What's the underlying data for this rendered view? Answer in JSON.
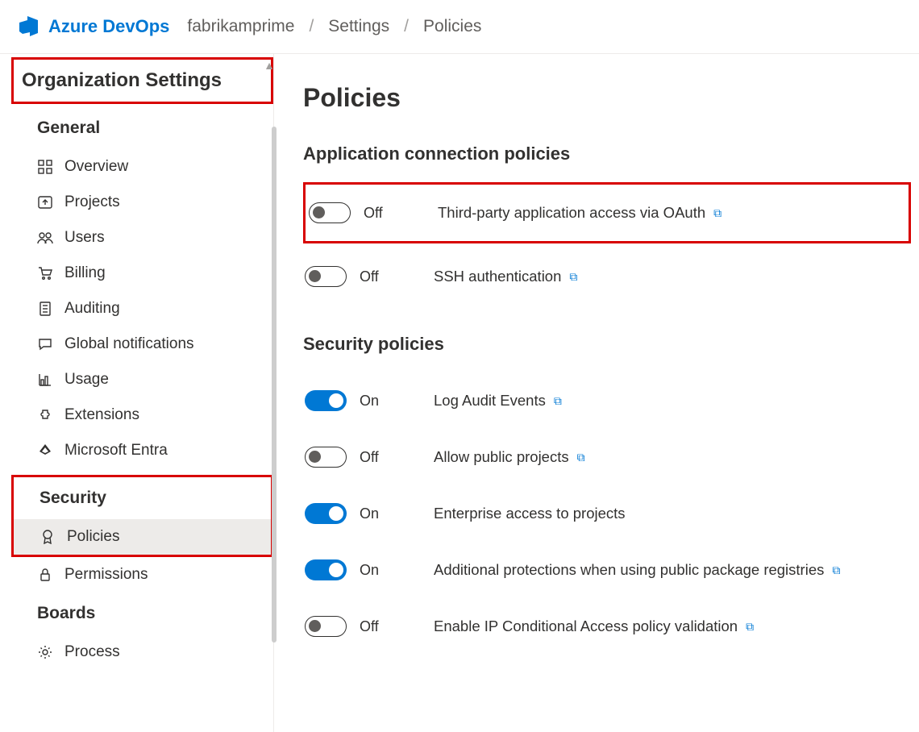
{
  "header": {
    "brand": "Azure DevOps",
    "breadcrumb": {
      "org": "fabrikamprime",
      "settings": "Settings",
      "policies": "Policies"
    }
  },
  "sidebar": {
    "title": "Organization Settings",
    "general_heading": "General",
    "general": {
      "overview": "Overview",
      "projects": "Projects",
      "users": "Users",
      "billing": "Billing",
      "auditing": "Auditing",
      "global_notifications": "Global notifications",
      "usage": "Usage",
      "extensions": "Extensions",
      "entra": "Microsoft Entra"
    },
    "security_heading": "Security",
    "security": {
      "policies": "Policies",
      "permissions": "Permissions"
    },
    "boards_heading": "Boards",
    "boards": {
      "process": "Process"
    }
  },
  "main": {
    "title": "Policies",
    "app_conn_heading": "Application connection policies",
    "sec_policies_heading": "Security policies",
    "on": "On",
    "off": "Off",
    "policies": {
      "oauth": "Third-party application access via OAuth",
      "ssh": "SSH authentication",
      "audit": "Log Audit Events",
      "public_projects": "Allow public projects",
      "enterprise": "Enterprise access to projects",
      "pkg_registries": "Additional protections when using public package registries",
      "ip_conditional": "Enable IP Conditional Access policy validation"
    }
  }
}
